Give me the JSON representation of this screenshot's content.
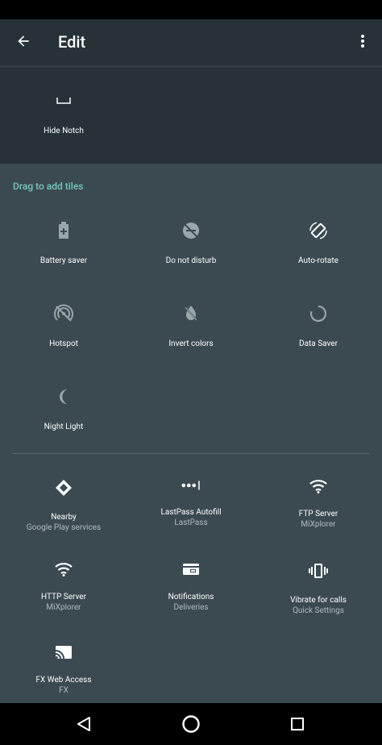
{
  "header": {
    "title": "Edit",
    "back_icon": "arrow-back-icon",
    "menu_icon": "more-vert-icon"
  },
  "current_tiles": [
    {
      "label": "Hide Notch",
      "icon": "notch-icon"
    }
  ],
  "section_title": "Drag to add tiles",
  "available_tiles": [
    {
      "label": "Battery saver",
      "icon": "battery-icon"
    },
    {
      "label": "Do not disturb",
      "icon": "dnd-icon"
    },
    {
      "label": "Auto-rotate",
      "icon": "rotate-icon"
    },
    {
      "label": "Hotspot",
      "icon": "hotspot-icon"
    },
    {
      "label": "Invert colors",
      "icon": "invert-icon"
    },
    {
      "label": "Data Saver",
      "icon": "data-saver-icon"
    },
    {
      "label": "Night Light",
      "icon": "moon-icon"
    }
  ],
  "app_tiles": [
    {
      "label": "Nearby",
      "sub": "Google Play services",
      "icon": "diamond-icon"
    },
    {
      "label": "LastPass Autofill",
      "sub": "LastPass",
      "icon": "password-icon"
    },
    {
      "label": "FTP Server",
      "sub": "MiXplorer",
      "icon": "wifi-icon"
    },
    {
      "label": "HTTP Server",
      "sub": "MiXplorer",
      "icon": "wifi-icon"
    },
    {
      "label": "Notifications",
      "sub": "Deliveries",
      "icon": "card-icon"
    },
    {
      "label": "Vibrate for calls",
      "sub": "Quick Settings",
      "icon": "vibrate-icon"
    },
    {
      "label": "FX Web Access",
      "sub": "FX",
      "icon": "cast-icon"
    }
  ],
  "navbar": {
    "back": "nav-back-icon",
    "home": "nav-home-icon",
    "recents": "nav-recents-icon"
  }
}
